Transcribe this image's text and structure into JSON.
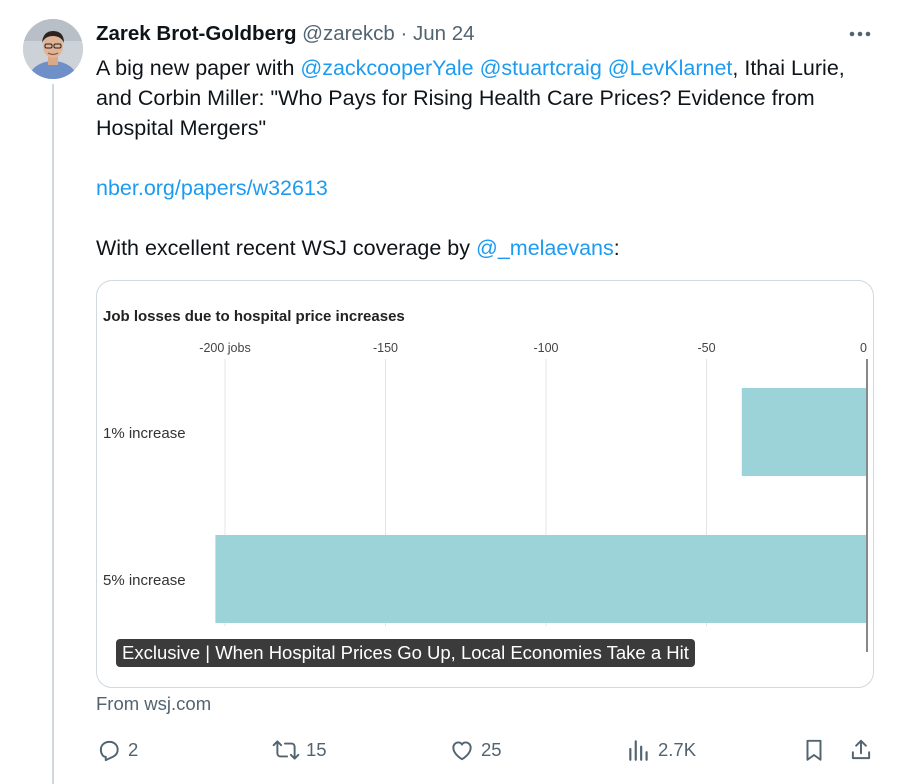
{
  "tweet": {
    "author_name": "Zarek Brot-Goldberg",
    "handle": "@zarekcb",
    "separator": "·",
    "date": "Jun 24",
    "text_intro": "A big new paper with ",
    "mentions": [
      "@zackcooperYale",
      "@stuartcraig",
      "@LevKlarnet"
    ],
    "text_after_mentions": ", Ithai Lurie, and Corbin Miller: \"Who Pays for Rising Health Care Prices? Evidence from Hospital Mergers\"",
    "link": "nber.org/papers/w32613",
    "coverage_text": "With excellent recent WSJ coverage by ",
    "coverage_mention": "@_melaevans",
    "coverage_end": ":"
  },
  "card": {
    "caption": "Exclusive | When Hospital Prices Go Up, Local Economies Take a Hit",
    "source": "From wsj.com"
  },
  "chart_data": {
    "type": "bar",
    "orientation": "horizontal",
    "title": "Job losses due to hospital price increases",
    "x_ticks": [
      "-200 jobs",
      "-150",
      "-100",
      "-50",
      "0"
    ],
    "x_tick_values": [
      -200,
      -150,
      -100,
      -50,
      0
    ],
    "xlim": [
      -203,
      0
    ],
    "categories": [
      "1% increase",
      "5% increase"
    ],
    "values": [
      -39,
      -203
    ],
    "bar_color": "#9bd3d9",
    "grid": true
  },
  "actions": {
    "replies": "2",
    "reposts": "15",
    "likes": "25",
    "views": "2.7K"
  }
}
